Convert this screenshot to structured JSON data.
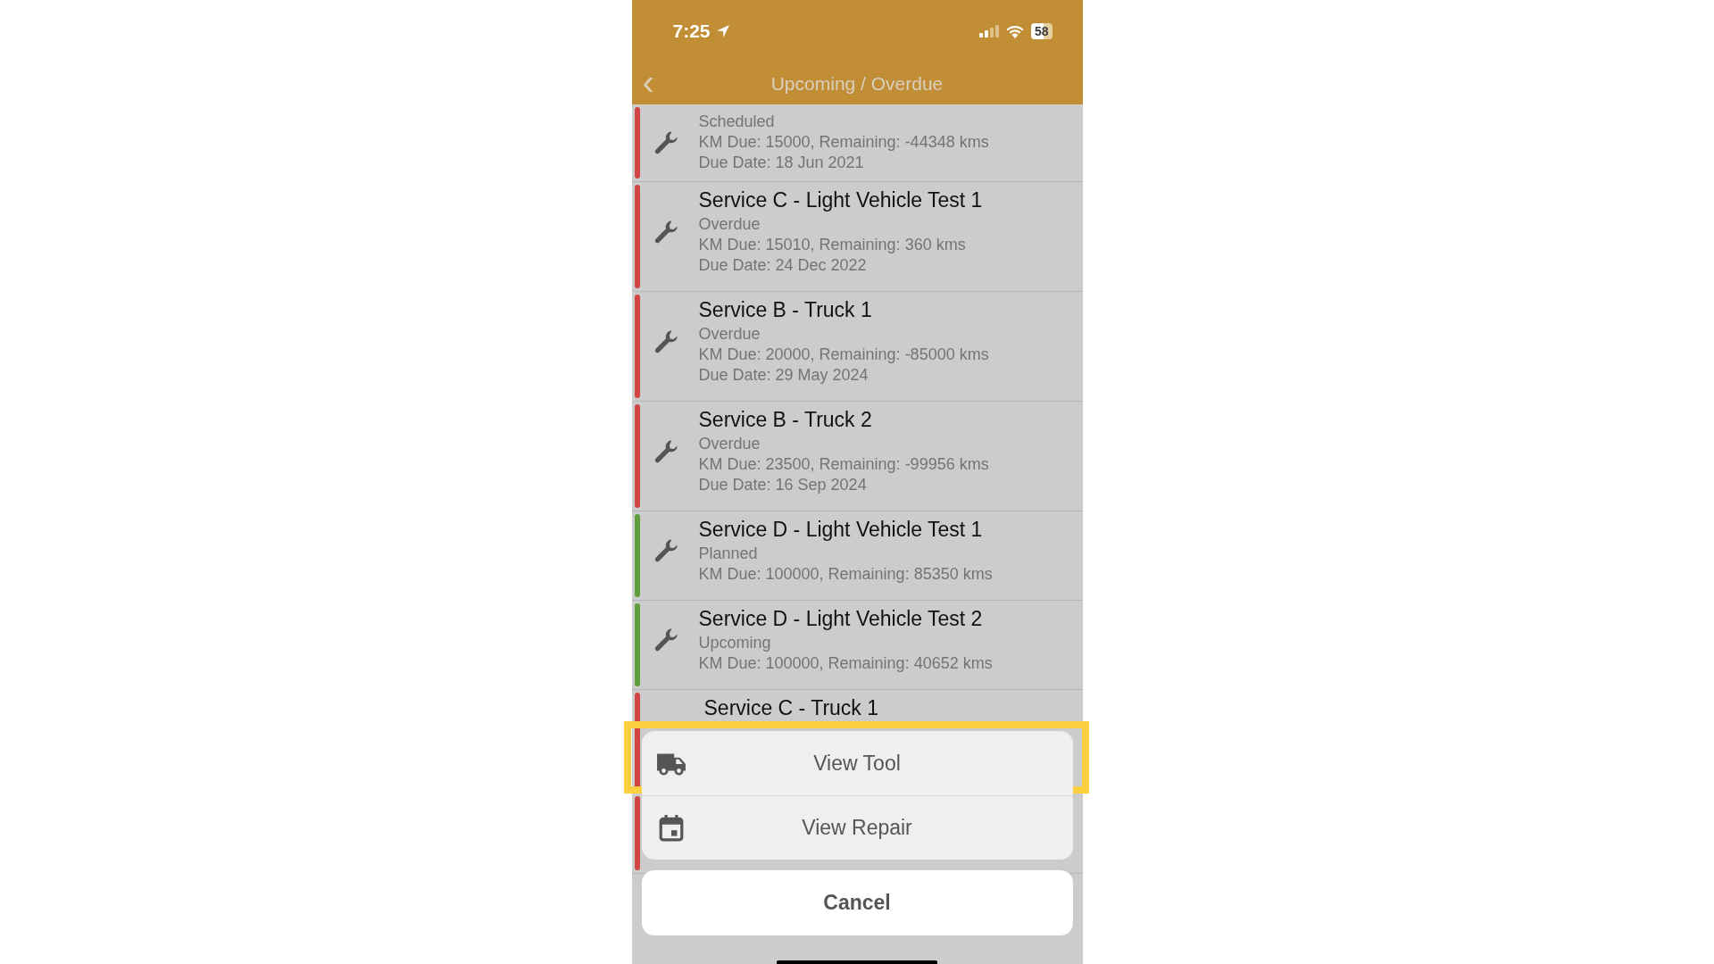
{
  "status_bar": {
    "time": "7:25",
    "battery": "58"
  },
  "nav": {
    "back": "‹",
    "title": "Upcoming / Overdue"
  },
  "rows": [
    {
      "color": "#d04444",
      "status": "Scheduled",
      "km": "KM Due: 15000, Remaining: -44348 kms",
      "due_date": "Due Date: 18 Jun 2021"
    },
    {
      "color": "#d04444",
      "title": "Service C - Light Vehicle Test 1",
      "status": "Overdue",
      "km": "KM Due: 15010, Remaining: 360 kms",
      "due_date": "Due Date: 24 Dec 2022"
    },
    {
      "color": "#d04444",
      "title": "Service B - Truck 1",
      "status": "Overdue",
      "km": "KM Due: 20000, Remaining: -85000 kms",
      "due_date": "Due Date: 29 May 2024"
    },
    {
      "color": "#d04444",
      "title": "Service B - Truck 2",
      "status": "Overdue",
      "km": "KM Due: 23500, Remaining: -99956 kms",
      "due_date": "Due Date: 16 Sep 2024"
    },
    {
      "color": "#5e9e3c",
      "title": "Service D - Light Vehicle Test 1",
      "status": "Planned",
      "km": "KM Due: 100000, Remaining: 85350 kms"
    },
    {
      "color": "#5e9e3c",
      "title": "Service D - Light Vehicle Test 2",
      "status": "Upcoming",
      "km": "KM Due: 100000, Remaining: 40652 kms"
    },
    {
      "color": "#d04444",
      "title": "Service C - Truck 1"
    },
    {
      "color": "#d04444"
    }
  ],
  "action_sheet": {
    "actions": [
      {
        "kind": "truck",
        "label": "View Tool",
        "highlighted": true
      },
      {
        "kind": "calendar",
        "label": "View Repair",
        "highlighted": false
      }
    ],
    "cancel": "Cancel"
  }
}
